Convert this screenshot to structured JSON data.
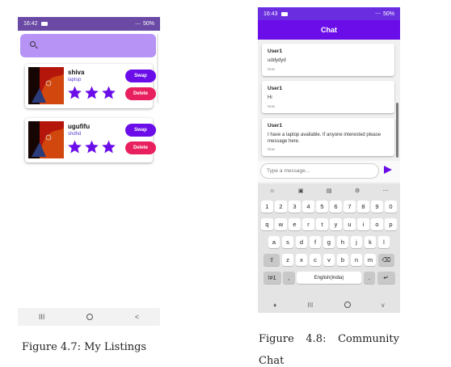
{
  "left_phone": {
    "status": {
      "time": "16:42",
      "battery": "50%"
    },
    "listings": [
      {
        "title": "shiva",
        "subtitle": "laptop",
        "rating": 3,
        "swap_label": "Swap",
        "delete_label": "Delete"
      },
      {
        "title": "ugufifu",
        "subtitle": "shdhd",
        "rating": 3,
        "swap_label": "Swap",
        "delete_label": "Delete"
      }
    ],
    "nav": {
      "recent": "III",
      "home": "O",
      "back": "<"
    },
    "colors": {
      "status_bar": "#6a4aa5",
      "search_bar": "#b793f5",
      "swap": "#6a0de8",
      "delete": "#e8205f",
      "star": "#6a0de8"
    }
  },
  "caption_left": "Figure 4.7: My Listings",
  "right_phone": {
    "status": {
      "time": "16:43",
      "battery": "50%"
    },
    "app_title": "Chat",
    "messages": [
      {
        "user": "User1",
        "text": "uddydyd",
        "time": "Now"
      },
      {
        "user": "User1",
        "text": "Hi",
        "time": "Now"
      },
      {
        "user": "User1",
        "text": "I have a laptop available. If anyone interested please message here.",
        "time": "Now"
      }
    ],
    "input_placeholder": "Type a message...",
    "keyboard": {
      "numbers": [
        "1",
        "2",
        "3",
        "4",
        "5",
        "6",
        "7",
        "8",
        "9",
        "0"
      ],
      "row1": [
        "q",
        "w",
        "e",
        "r",
        "t",
        "y",
        "u",
        "i",
        "o",
        "p"
      ],
      "row2": [
        "a",
        "s",
        "d",
        "f",
        "g",
        "h",
        "j",
        "k",
        "l"
      ],
      "row3": [
        "z",
        "x",
        "c",
        "v",
        "b",
        "n",
        "m"
      ],
      "symbols_key": "!#1",
      "comma_key": ",",
      "space_label": "English(India)",
      "period_key": "."
    },
    "nav": {
      "recent": "III",
      "home": "O",
      "back": "v"
    },
    "colors": {
      "app_bar": "#6a0de8",
      "send": "#6a0de8"
    }
  },
  "caption_right": {
    "line1_word1": "Figure",
    "line1_word2": "4.8:",
    "line1_word3": "Community",
    "line2": "Chat"
  }
}
